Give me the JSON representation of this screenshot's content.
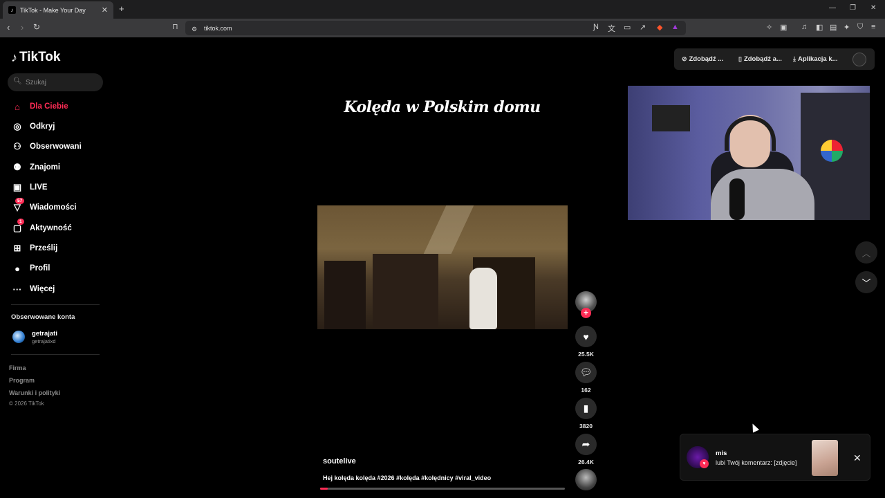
{
  "browser": {
    "tab_title": "TikTok - Make Your Day",
    "new_tab": "+",
    "url": "tiktok.com",
    "window_controls": [
      "—",
      "❐",
      "✕"
    ]
  },
  "sidebar": {
    "logo": "TikTok",
    "search_placeholder": "Szukaj",
    "items": [
      {
        "label": "Dla Ciebie",
        "icon": "home-icon",
        "active": true
      },
      {
        "label": "Odkryj",
        "icon": "compass-icon"
      },
      {
        "label": "Obserwowani",
        "icon": "following-icon"
      },
      {
        "label": "Znajomi",
        "icon": "friends-icon"
      },
      {
        "label": "LIVE",
        "icon": "live-icon"
      },
      {
        "label": "Wiadomości",
        "icon": "messages-icon",
        "badge": "57"
      },
      {
        "label": "Aktywność",
        "icon": "activity-icon",
        "badge": "1"
      },
      {
        "label": "Prześlij",
        "icon": "upload-icon"
      },
      {
        "label": "Profil",
        "icon": "profile-icon"
      },
      {
        "label": "Więcej",
        "icon": "more-icon"
      }
    ],
    "followed_title": "Obserwowane konta",
    "followed": [
      {
        "name": "getrajati",
        "handle": "getrajatixd"
      }
    ],
    "footer": [
      "Firma",
      "Program",
      "Warunki i polityki"
    ],
    "copyright": "© 2026 TikTok"
  },
  "top_buttons": {
    "coins": "Zdobądź ...",
    "app_get": "Zdobądź a...",
    "app_download": "Aplikacja k..."
  },
  "video": {
    "overlay_title": "Kolęda w Polskim domu",
    "author": "soutelive",
    "description": "Hej kolęda kolęda #2026 #kolęda #kolędnicy #viral_video",
    "progress_fraction": 0.03,
    "likes": "25.5K",
    "comments": "162",
    "saves": "3820",
    "shares": "26.4K"
  },
  "notification": {
    "name": "mis",
    "text": "lubi Twój komentarz: [zdjęcie]"
  },
  "colors": {
    "accent": "#fe2c55",
    "background": "#000000"
  }
}
